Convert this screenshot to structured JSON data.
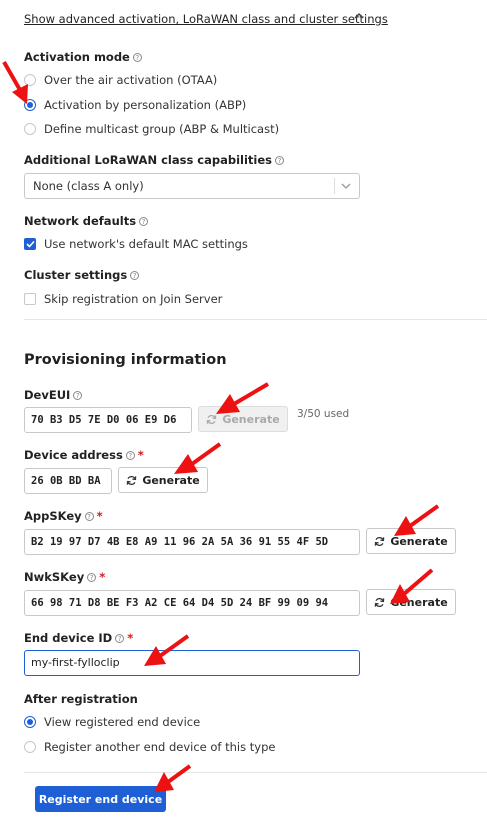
{
  "advanced_toggle": {
    "label": "Show advanced activation, LoRaWAN class and cluster settings"
  },
  "activation": {
    "title": "Activation mode",
    "options": [
      {
        "label": "Over the air activation (OTAA)",
        "selected": false
      },
      {
        "label": "Activation by personalization (ABP)",
        "selected": true
      },
      {
        "label": "Define multicast group (ABP & Multicast)",
        "selected": false
      }
    ]
  },
  "class_caps": {
    "title": "Additional LoRaWAN class capabilities",
    "value": "None (class A only)"
  },
  "network_defaults": {
    "title": "Network defaults",
    "checkbox_label": "Use network's default MAC settings",
    "checked": true
  },
  "cluster_settings": {
    "title": "Cluster settings",
    "checkbox_label": "Skip registration on Join Server",
    "checked": false
  },
  "provisioning": {
    "title": "Provisioning information",
    "dev_eui": {
      "label": "DevEUI",
      "value": "70 B3 D5 7E D0 06 E9 D6",
      "generate_label": "Generate",
      "usage": "3/50 used"
    },
    "device_address": {
      "label": "Device address",
      "required_mark": "*",
      "value": "26 0B BD BA",
      "generate_label": "Generate"
    },
    "app_s_key": {
      "label": "AppSKey",
      "required_mark": "*",
      "value": "B2 19 97 D7 4B E8 A9 11 96 2A 5A 36 91 55 4F 5D",
      "generate_label": "Generate"
    },
    "nwk_s_key": {
      "label": "NwkSKey",
      "required_mark": "*",
      "value": "66 98 71 D8 BE F3 A2 CE 64 D4 5D 24 BF 99 09 94",
      "generate_label": "Generate"
    },
    "end_device_id": {
      "label": "End device ID",
      "required_mark": "*",
      "value": "my-first-fylloclip"
    }
  },
  "after_registration": {
    "title": "After registration",
    "options": [
      {
        "label": "View registered end device",
        "selected": true
      },
      {
        "label": "Register another end device of this type",
        "selected": false
      }
    ]
  },
  "submit": {
    "label": "Register end device"
  },
  "icons": {
    "help": "question-circle-icon",
    "refresh": "refresh-icon",
    "chevron_up": "chevron-up-icon",
    "chevron_down": "chevron-down-icon",
    "annotation_arrow": "red-arrow-icon"
  },
  "colors": {
    "accent": "#1e5fd6",
    "required": "#d11c1c",
    "annotation": "#ee1111"
  }
}
